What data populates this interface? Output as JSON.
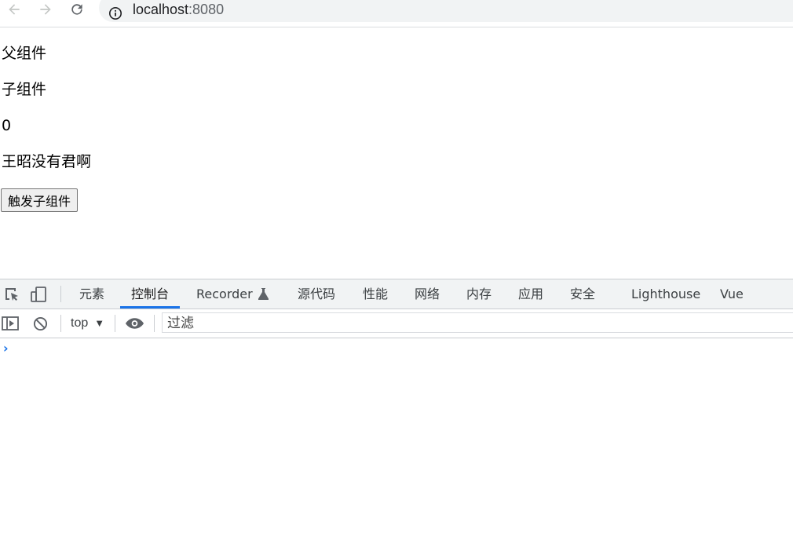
{
  "browser": {
    "url_host": "localhost",
    "url_port": ":8080",
    "icons": [
      "back-arrow-icon",
      "forward-arrow-icon",
      "reload-icon",
      "info-icon"
    ]
  },
  "page": {
    "parent_text": "父组件",
    "child_text": "子组件",
    "count": "0",
    "name_text": "王昭没有君啊",
    "button_label": "触发子组件"
  },
  "devtools": {
    "tabs": [
      "元素",
      "控制台",
      "Recorder",
      "源代码",
      "性能",
      "网络",
      "内存",
      "应用",
      "安全",
      "Lighthouse",
      "Vue"
    ],
    "active_tab": "控制台",
    "context": "top",
    "filter_placeholder": "过滤",
    "accent_color": "#1a73e8"
  }
}
